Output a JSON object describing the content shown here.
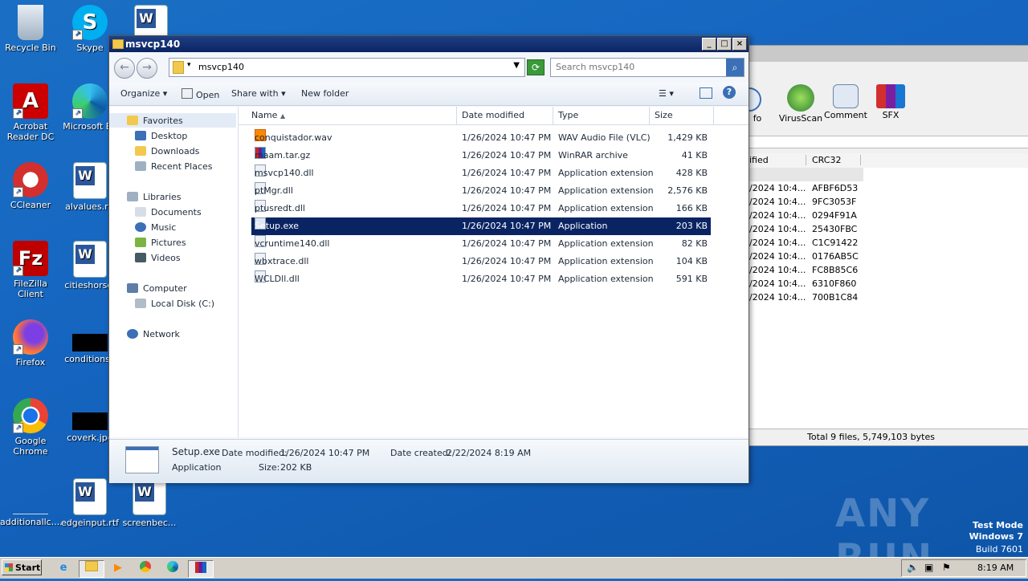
{
  "desktop": {
    "icons": [
      {
        "label": "Recycle Bin"
      },
      {
        "label": "Skype"
      },
      {
        "label": "Acrobat Reader DC"
      },
      {
        "label": "Microsoft Ed"
      },
      {
        "label": "CCleaner"
      },
      {
        "label": "alvalues.rtf"
      },
      {
        "label": "FileZilla Client"
      },
      {
        "label": "citieshorse."
      },
      {
        "label": "Firefox"
      },
      {
        "label": "conditionsh"
      },
      {
        "label": "Google Chrome"
      },
      {
        "label": "coverk.jpg"
      },
      {
        "label": "additionallc...."
      },
      {
        "label": "edgeinput.rtf"
      },
      {
        "label": "screenbec..."
      }
    ],
    "watermark": "ANY RUN",
    "test_mode": {
      "line1": "Test Mode",
      "line2": "Windows 7",
      "line3": "Build 7601"
    }
  },
  "rar_window": {
    "toolbar": [
      {
        "label": "fo"
      },
      {
        "label": "VirusScan"
      },
      {
        "label": "Comment"
      },
      {
        "label": "SFX"
      }
    ],
    "columns": {
      "modified": "ified",
      "crc": "CRC32"
    },
    "rows": [
      {
        "modified": "",
        "crc": ""
      },
      {
        "modified": "/2024 10:4...",
        "crc": "AFBF6D53"
      },
      {
        "modified": "/2024 10:4...",
        "crc": "9FC3053F"
      },
      {
        "modified": "/2024 10:4...",
        "crc": "0294F91A"
      },
      {
        "modified": "/2024 10:4...",
        "crc": "25430FBC"
      },
      {
        "modified": "/2024 10:4...",
        "crc": "C1C91422"
      },
      {
        "modified": "/2024 10:4...",
        "crc": "0176AB5C"
      },
      {
        "modified": "/2024 10:4...",
        "crc": "FC8B85C6"
      },
      {
        "modified": "/2024 10:4...",
        "crc": "6310F860"
      },
      {
        "modified": "/2024 10:4...",
        "crc": "700B1C84"
      }
    ],
    "status": "Total 9 files, 5,749,103 bytes"
  },
  "explorer": {
    "title": "msvcp140",
    "address": "msvcp140",
    "search_placeholder": "Search msvcp140",
    "commands": {
      "organize": "Organize",
      "open": "Open",
      "share": "Share with",
      "new_folder": "New folder"
    },
    "nav": {
      "favorites": "Favorites",
      "desktop": "Desktop",
      "downloads": "Downloads",
      "recent": "Recent Places",
      "libraries": "Libraries",
      "documents": "Documents",
      "music": "Music",
      "pictures": "Pictures",
      "videos": "Videos",
      "computer": "Computer",
      "local_disk": "Local Disk (C:)",
      "network": "Network"
    },
    "columns": {
      "name": "Name",
      "date": "Date modified",
      "type": "Type",
      "size": "Size"
    },
    "files": [
      {
        "name": "conquistador.wav",
        "date": "1/26/2024 10:47 PM",
        "type": "WAV Audio File (VLC)",
        "size": "1,429 KB"
      },
      {
        "name": "maam.tar.gz",
        "date": "1/26/2024 10:47 PM",
        "type": "WinRAR archive",
        "size": "41 KB"
      },
      {
        "name": "msvcp140.dll",
        "date": "1/26/2024 10:47 PM",
        "type": "Application extension",
        "size": "428 KB"
      },
      {
        "name": "ptMgr.dll",
        "date": "1/26/2024 10:47 PM",
        "type": "Application extension",
        "size": "2,576 KB"
      },
      {
        "name": "ptusredt.dll",
        "date": "1/26/2024 10:47 PM",
        "type": "Application extension",
        "size": "166 KB"
      },
      {
        "name": "Setup.exe",
        "date": "1/26/2024 10:47 PM",
        "type": "Application",
        "size": "203 KB"
      },
      {
        "name": "vcruntime140.dll",
        "date": "1/26/2024 10:47 PM",
        "type": "Application extension",
        "size": "82 KB"
      },
      {
        "name": "wbxtrace.dll",
        "date": "1/26/2024 10:47 PM",
        "type": "Application extension",
        "size": "104 KB"
      },
      {
        "name": "WCLDll.dll",
        "date": "1/26/2024 10:47 PM",
        "type": "Application extension",
        "size": "591 KB"
      }
    ],
    "details": {
      "name": "Setup.exe",
      "modified_label": "Date modified:",
      "modified": "1/26/2024 10:47 PM",
      "created_label": "Date created:",
      "created": "2/22/2024 8:19 AM",
      "type": "Application",
      "size_label": "Size:",
      "size": "202 KB"
    }
  },
  "taskbar": {
    "start": "Start",
    "clock": "8:19 AM"
  }
}
